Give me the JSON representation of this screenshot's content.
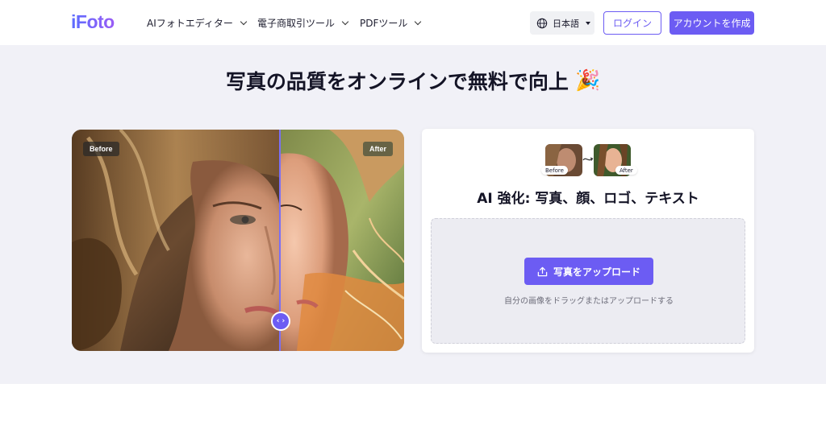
{
  "header": {
    "logo_text": "iFoto",
    "nav": [
      {
        "label": "AIフォトエディター"
      },
      {
        "label": "電子商取引ツール"
      },
      {
        "label": "PDFツール"
      }
    ],
    "language": "日本語",
    "login_label": "ログイン",
    "create_account_label": "アカウントを作成"
  },
  "hero": {
    "title": "写真の品質をオンラインで無料で向上",
    "title_emoji": "🎉",
    "compare": {
      "before_label": "Before",
      "after_label": "After",
      "slider_position_percent": 63
    }
  },
  "upload_card": {
    "thumb_before_label": "Before",
    "thumb_after_label": "After",
    "title": "AI 強化: 写真、顔、ロゴ、テキスト",
    "upload_button_label": "写真をアップロード",
    "hint": "自分の画像をドラッグまたはアップロードする"
  },
  "colors": {
    "accent": "#6c5cf3",
    "hero_bg": "#f1f1f7",
    "dropzone_bg": "#ececf2"
  }
}
